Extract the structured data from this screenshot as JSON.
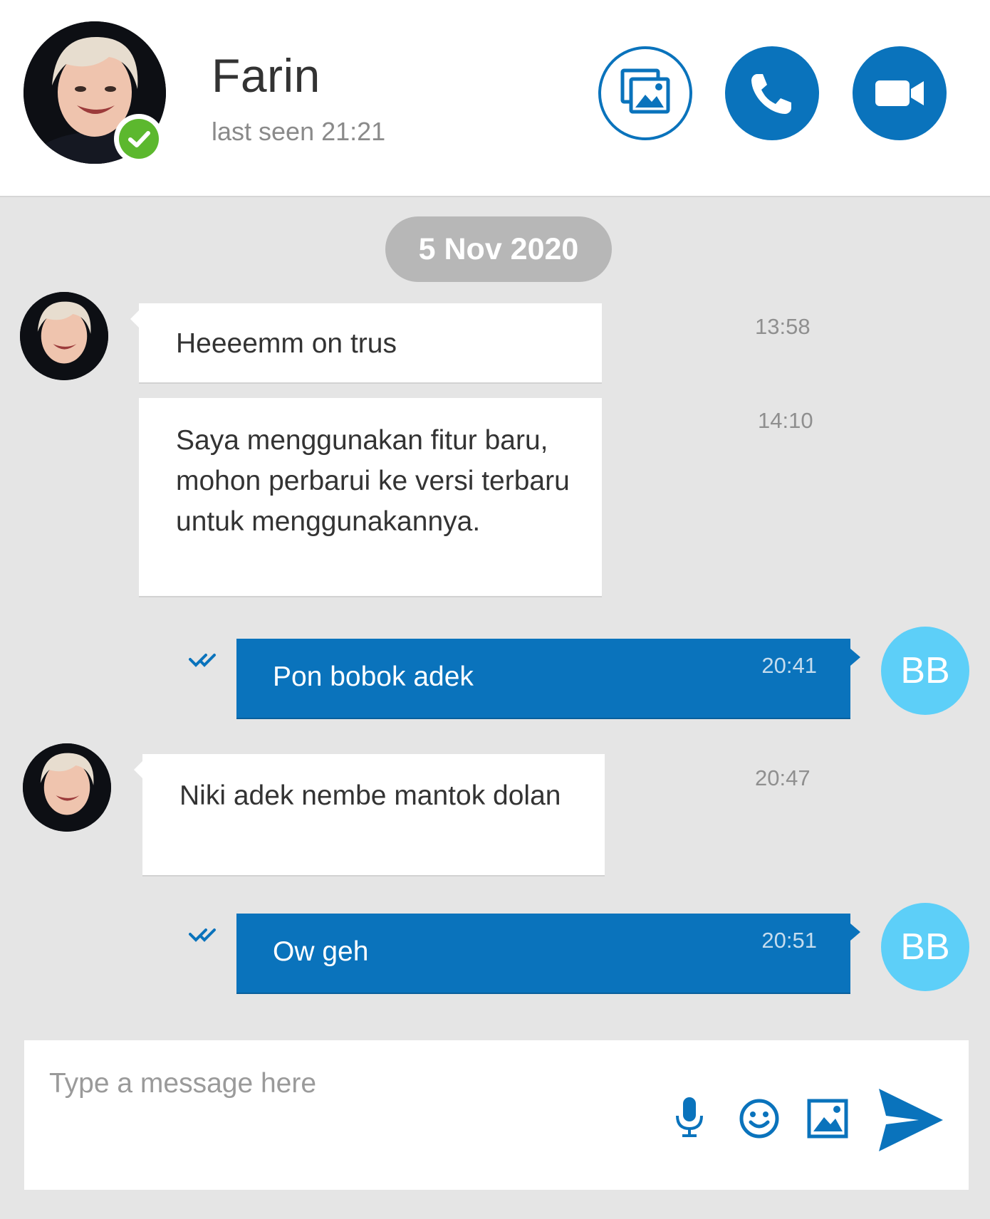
{
  "header": {
    "contact_name": "Farin",
    "status": "last seen 21:21",
    "presence": "online",
    "actions": [
      {
        "icon": "gallery-icon"
      },
      {
        "icon": "phone-icon"
      },
      {
        "icon": "video-camera-icon"
      }
    ]
  },
  "date_separator": "5 Nov 2020",
  "messages": [
    {
      "direction": "incoming",
      "text": "Heeeemm on trus",
      "time": "13:58"
    },
    {
      "direction": "incoming",
      "text": "Saya menggunakan fitur baru, mohon perbarui ke versi terbaru untuk menggunakannya.",
      "time": "14:10"
    },
    {
      "direction": "outgoing",
      "text": "Pon bobok adek",
      "time": "20:41",
      "status": "read",
      "sender_initials": "BB"
    },
    {
      "direction": "incoming",
      "text": "Niki adek nembe mantok dolan",
      "time": "20:47"
    },
    {
      "direction": "outgoing",
      "text": "Ow geh",
      "time": "20:51",
      "status": "read",
      "sender_initials": "BB"
    }
  ],
  "composer": {
    "placeholder": "Type a message here",
    "actions": [
      {
        "icon": "microphone-icon"
      },
      {
        "icon": "emoji-icon"
      },
      {
        "icon": "image-icon"
      },
      {
        "icon": "send-icon"
      }
    ]
  },
  "colors": {
    "accent": "#0a73bc",
    "online": "#5cb82e",
    "initials_bg": "#5dcff8",
    "chat_bg": "#e5e5e5",
    "date_pill": "#b7b7b7"
  }
}
